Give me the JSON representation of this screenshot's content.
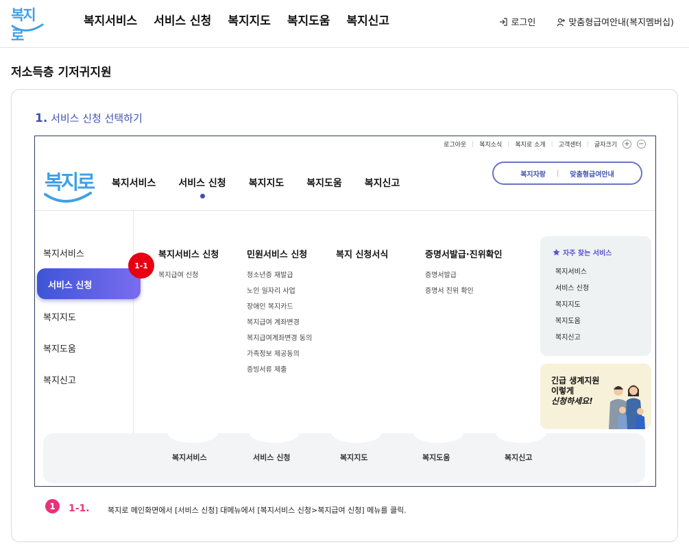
{
  "header": {
    "logo_text": "복지로",
    "nav": [
      "복지서비스",
      "서비스 신청",
      "복지지도",
      "복지도움",
      "복지신고"
    ],
    "login": "로그인",
    "membership": "맞춤형급여안내(복지멤버십)"
  },
  "page_title": "저소득층 기저귀지원",
  "step": {
    "number": "1.",
    "label": "서비스 신청 선택하기"
  },
  "shot": {
    "util": [
      "로그아웃",
      "복지소식",
      "복지로 소개",
      "고객센터",
      "글자크기"
    ],
    "logo_text": "복지로",
    "nav": [
      "복지서비스",
      "서비스 신청",
      "복지지도",
      "복지도움",
      "복지신고"
    ],
    "pill": {
      "left": "복지자랑",
      "right": "맞춤형급여안내"
    },
    "left_menu": [
      "복지서비스",
      "서비스 신청",
      "복지지도",
      "복지도움",
      "복지신고"
    ],
    "badge": "1-1",
    "columns": [
      {
        "title": "복지서비스 신청",
        "items": [
          "복지급여 신청"
        ]
      },
      {
        "title": "민원서비스 신청",
        "items": [
          "청소년증 재발급",
          "노인 일자리 사업",
          "장애인 복지카드",
          "복지급여 계좌변경",
          "복지급여계좌변경 동의",
          "가족정보 제공동의",
          "증빙서류 제출"
        ]
      },
      {
        "title": "복지 신청서식",
        "items": []
      },
      {
        "title": "증명서발급·진위확인",
        "items": [
          "증명서발급",
          "증명서 진위 확인"
        ]
      }
    ],
    "frequent": {
      "title": "자주 찾는 서비스",
      "items": [
        "복지서비스",
        "서비스 신청",
        "복지지도",
        "복지도움",
        "복지신고"
      ]
    },
    "promo": {
      "line1": "긴급 생계지원",
      "line2": "이렇게",
      "line3": "신청하세요!"
    },
    "bottom_nav": [
      "복지서비스",
      "서비스 신청",
      "복지지도",
      "복지도움",
      "복지신고"
    ]
  },
  "note": {
    "number": "1",
    "label": "1-1.",
    "text": "복지로 메인화면에서 [서비스 신청] 대메뉴에서 [복지서비스 신청>복지급여 신청] 메뉴를 클릭."
  }
}
